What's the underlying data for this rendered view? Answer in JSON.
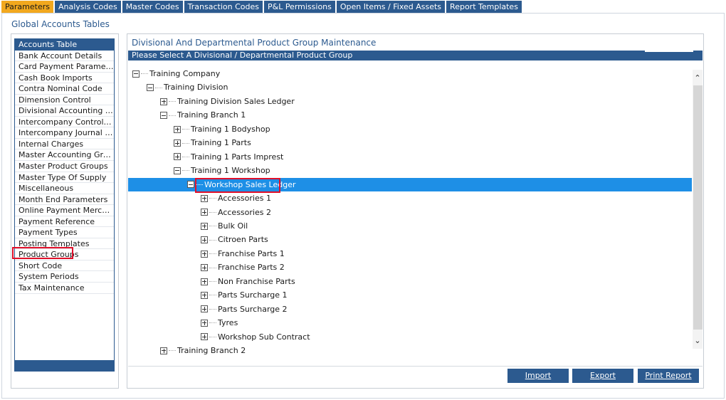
{
  "tabs": [
    {
      "label": "Parameters",
      "active": true
    },
    {
      "label": "Analysis Codes",
      "active": false
    },
    {
      "label": "Master Codes",
      "active": false
    },
    {
      "label": "Transaction Codes",
      "active": false
    },
    {
      "label": "P&L Permissions",
      "active": false
    },
    {
      "label": "Open Items / Fixed Assets",
      "active": false
    },
    {
      "label": "Report Templates",
      "active": false
    }
  ],
  "page_title": "Global Accounts Tables",
  "left_list": [
    {
      "label": "Accounts Table",
      "selected": true
    },
    {
      "label": "Bank Account Details"
    },
    {
      "label": "Card Payment Parameters"
    },
    {
      "label": "Cash Book Imports"
    },
    {
      "label": "Contra Nominal Code"
    },
    {
      "label": "Dimension Control"
    },
    {
      "label": "Divisional Accounting Gro..."
    },
    {
      "label": "Intercompany Control Co..."
    },
    {
      "label": "Intercompany Journal Co..."
    },
    {
      "label": "Internal Charges"
    },
    {
      "label": "Master Accounting Groups"
    },
    {
      "label": "Master Product Groups"
    },
    {
      "label": "Master Type Of Supply"
    },
    {
      "label": "Miscellaneous"
    },
    {
      "label": "Month End Parameters"
    },
    {
      "label": "Online Payment Merchants"
    },
    {
      "label": "Payment Reference"
    },
    {
      "label": "Payment Types"
    },
    {
      "label": "Posting Templates"
    },
    {
      "label": "Product Groups",
      "highlighted": true
    },
    {
      "label": "Short Code"
    },
    {
      "label": "System Periods"
    },
    {
      "label": "Tax Maintenance"
    }
  ],
  "panel": {
    "title": "Divisional And Departmental Product Group Maintenance",
    "prompt": "Please Select A Divisional / Departmental Product Group"
  },
  "tree": [
    {
      "label": "Training Company",
      "level": 0,
      "expanded": true
    },
    {
      "label": "Training Division",
      "level": 1,
      "expanded": true
    },
    {
      "label": "Training Division Sales Ledger",
      "level": 2,
      "expanded": false
    },
    {
      "label": "Training Branch 1",
      "level": 2,
      "expanded": true
    },
    {
      "label": "Training 1 Bodyshop",
      "level": 3,
      "expanded": false
    },
    {
      "label": "Training 1 Parts",
      "level": 3,
      "expanded": false
    },
    {
      "label": "Training 1 Parts Imprest",
      "level": 3,
      "expanded": false
    },
    {
      "label": "Training 1 Workshop",
      "level": 3,
      "expanded": true
    },
    {
      "label": "Workshop Sales Ledger",
      "level": 4,
      "expanded": true,
      "selected": true
    },
    {
      "label": "Accessories 1",
      "level": 5,
      "expanded": false
    },
    {
      "label": "Accessories 2",
      "level": 5,
      "expanded": false
    },
    {
      "label": "Bulk Oil",
      "level": 5,
      "expanded": false
    },
    {
      "label": "Citroen Parts",
      "level": 5,
      "expanded": false
    },
    {
      "label": "Franchise Parts 1",
      "level": 5,
      "expanded": false
    },
    {
      "label": "Franchise Parts 2",
      "level": 5,
      "expanded": false
    },
    {
      "label": "Non Franchise Parts",
      "level": 5,
      "expanded": false
    },
    {
      "label": "Parts Surcharge 1",
      "level": 5,
      "expanded": false
    },
    {
      "label": "Parts Surcharge 2",
      "level": 5,
      "expanded": false
    },
    {
      "label": "Tyres",
      "level": 5,
      "expanded": false
    },
    {
      "label": "Workshop Sub Contract",
      "level": 5,
      "expanded": false
    },
    {
      "label": "Training Branch 2",
      "level": 2,
      "expanded": false
    }
  ],
  "buttons": {
    "import": "Import",
    "export": "Export",
    "print": "Print Report"
  },
  "colors": {
    "accent": "#2c5a8f",
    "active_tab": "#f2a81e",
    "selection": "#1e8fe6",
    "highlight_box": "#e0102a"
  }
}
